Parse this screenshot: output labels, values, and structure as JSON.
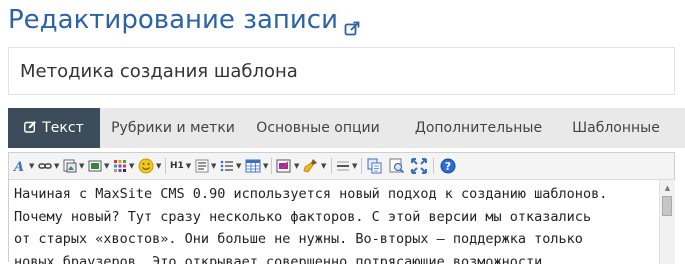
{
  "page": {
    "title": "Редактирование записи",
    "external_link_icon": "external-link-icon"
  },
  "title_input": {
    "value": "Методика создания шаблона"
  },
  "tabs": [
    {
      "label": "Текст",
      "icon": "pencil-square-icon",
      "active": true
    },
    {
      "label": "Рубрики и метки",
      "active": false
    },
    {
      "label": "Основные опции",
      "active": false
    },
    {
      "label": "Дополнительные",
      "active": false
    },
    {
      "label": "Шаблонные",
      "active": false
    }
  ],
  "toolbar": {
    "groups": [
      [
        "font-color-icon",
        "link-icon",
        "insert-image-icon",
        "media-icon",
        "grid-icon",
        "smiley-icon"
      ],
      [
        "heading-icon",
        "paragraph-icon",
        "list-icon",
        "table-icon"
      ],
      [
        "code-check-icon",
        "clean-brush-icon"
      ],
      [
        "horizontal-rule-icon"
      ],
      [
        "copy-icon",
        "preview-icon",
        "fullscreen-icon"
      ],
      [
        "help-icon"
      ]
    ],
    "heading_label": "H1"
  },
  "editor": {
    "lines": [
      "Начиная с MaxSite CMS 0.90 используется новый подход к созданию шаблонов.",
      "Почему новый? Тут сразу несколько факторов. С этой версии мы отказались",
      "от старых «хвостов». Они больше не нужны. Во-вторых — поддержка только",
      "новых браузеров. Это открывает совершенно потрясающие возможности"
    ]
  },
  "colors": {
    "title": "#2a63a8",
    "tab_active_bg": "#3d4c5b",
    "tab_bar_bg": "#e9e9e9",
    "help_icon": "#2b6cd1"
  }
}
